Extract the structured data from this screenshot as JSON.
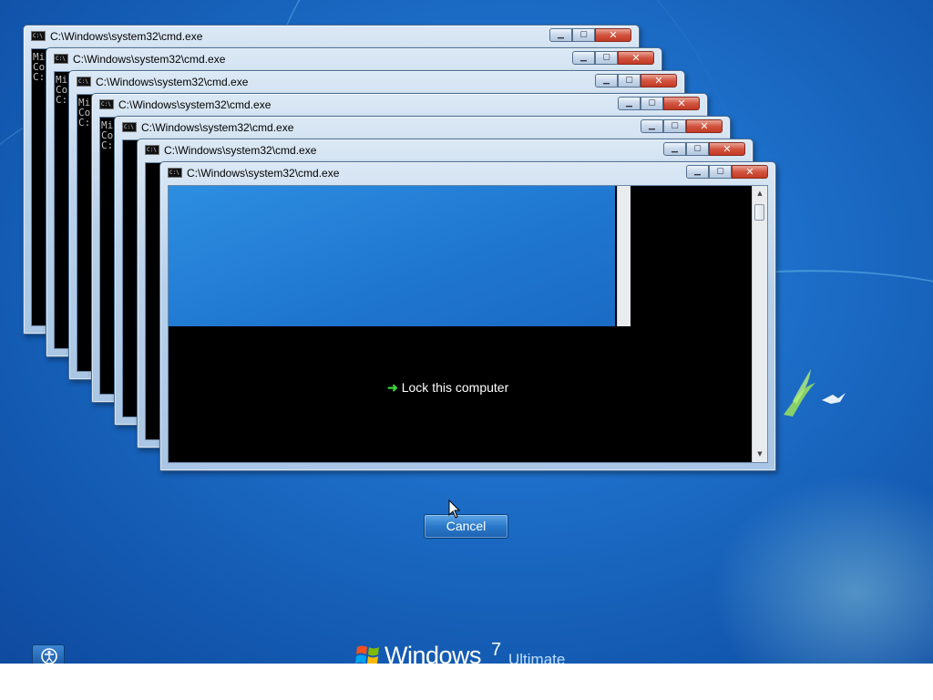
{
  "windows": {
    "title": "C:\\Windows\\system32\\cmd.exe",
    "console_lines": [
      "Mi",
      "Co",
      "",
      "C:"
    ],
    "minimize_glyph": "▁",
    "maximize_glyph": "▢",
    "close_glyph": "✕",
    "scroll_up_glyph": "▲",
    "scroll_down_glyph": "▼"
  },
  "lock_option": {
    "label": "Lock this computer",
    "icon": "green-arrow-icon"
  },
  "cancel_button": {
    "label": "Cancel"
  },
  "ease_of_access": {
    "icon": "ease-of-access-icon"
  },
  "branding": {
    "product": "Windows",
    "version": "7",
    "edition": "Ultimate",
    "logo": "windows-flag-icon"
  },
  "colors": {
    "desktop_blue": "#1d6fc9",
    "close_red": "#c23a25",
    "link_arrow_green": "#3fd13c"
  }
}
